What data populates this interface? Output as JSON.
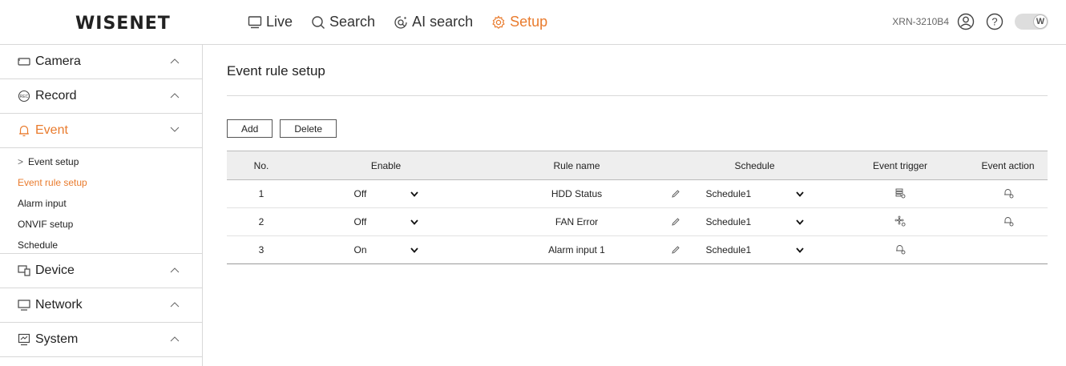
{
  "header": {
    "logo": "WISENET",
    "nav": [
      {
        "label": "Live",
        "icon": "monitor-icon"
      },
      {
        "label": "Search",
        "icon": "search-icon"
      },
      {
        "label": "AI search",
        "icon": "ai-search-icon"
      },
      {
        "label": "Setup",
        "icon": "gear-icon",
        "active": true
      }
    ],
    "model": "XRN-3210B4",
    "toggle_label": "W"
  },
  "sidebar": {
    "sections": [
      {
        "label": "Camera",
        "icon": "camera-icon"
      },
      {
        "label": "Record",
        "icon": "record-icon"
      },
      {
        "label": "Event",
        "icon": "bell-icon",
        "active": true
      },
      {
        "label": "Device",
        "icon": "device-icon"
      },
      {
        "label": "Network",
        "icon": "network-icon"
      },
      {
        "label": "System",
        "icon": "system-icon"
      }
    ],
    "event_items": [
      {
        "label": "Event setup",
        "has_arrow": true
      },
      {
        "label": "Event rule setup",
        "active": true
      },
      {
        "label": "Alarm input"
      },
      {
        "label": "ONVIF setup"
      },
      {
        "label": "Schedule"
      }
    ]
  },
  "main": {
    "title": "Event rule setup",
    "add_label": "Add",
    "delete_label": "Delete",
    "columns": [
      "No.",
      "Enable",
      "Rule name",
      "Schedule",
      "Event trigger",
      "Event action"
    ],
    "rows": [
      {
        "no": "1",
        "enable": "Off",
        "name": "HDD Status",
        "schedule": "Schedule1",
        "trigger_icon": "hdd-icon",
        "action_icon": "alarm-out-icon"
      },
      {
        "no": "2",
        "enable": "Off",
        "name": "FAN Error",
        "schedule": "Schedule1",
        "trigger_icon": "fan-icon",
        "action_icon": "alarm-out-icon"
      },
      {
        "no": "3",
        "enable": "On",
        "name": "Alarm input 1",
        "schedule": "Schedule1",
        "trigger_icon": "alarm-in-icon",
        "action_icon": ""
      }
    ]
  },
  "colors": {
    "accent": "#e97b2d",
    "border": "#d8d8d8",
    "table_header": "#eeeeee"
  }
}
